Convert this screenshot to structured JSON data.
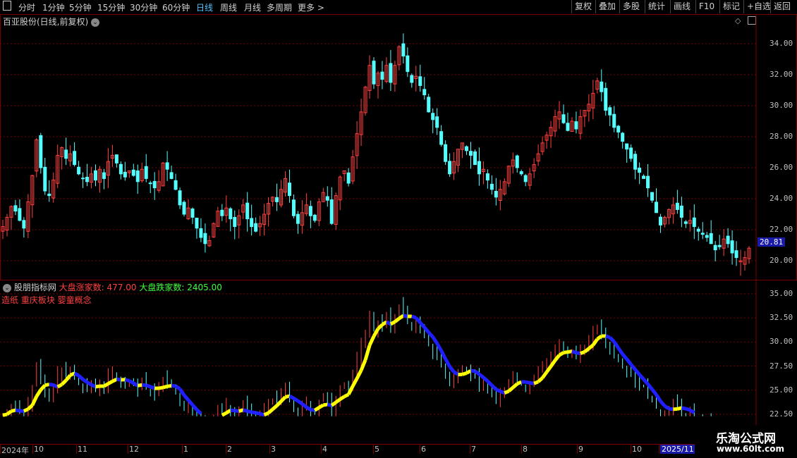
{
  "toolbar": {
    "left_items": [
      "分时",
      "1分钟",
      "5分钟",
      "15分钟",
      "30分钟",
      "60分钟",
      "日线",
      "周线",
      "月线",
      "多周期",
      "更多 >"
    ],
    "active_item": "日线",
    "right_items": [
      "复权",
      "叠加",
      "多股",
      "统计",
      "画线",
      "F10",
      "标记",
      "+自选",
      "返回"
    ]
  },
  "main_panel": {
    "title": "百亚股份(日线,前复权)",
    "price_axis": [
      "34.00",
      "32.00",
      "30.00",
      "28.00",
      "26.00",
      "24.00",
      "22.00",
      "20.00"
    ],
    "current_price": "20.81"
  },
  "indicator_panel": {
    "name": "股朋指标网",
    "up_label": "大盘涨家数: 477.00",
    "down_label": "大盘跌家数: 2405.00",
    "concepts": "造纸 重庆板块 婴童概念",
    "axis": [
      "35.00",
      "32.50",
      "30.00",
      "27.50",
      "25.00",
      "22.50"
    ]
  },
  "time_axis": {
    "labels": [
      "2024年",
      "10",
      "11",
      "12",
      "1",
      "2",
      "3",
      "4",
      "5",
      "6",
      "7",
      "8",
      "9",
      "10",
      "2025/11"
    ]
  },
  "watermark": {
    "line1": "乐淘公式网",
    "line2": "www.60lt.com"
  },
  "colors": {
    "up": "#ff4040",
    "down": "#54ffff",
    "line_up": "#ffff00",
    "line_down": "#2020ff",
    "grid": "#7a0000",
    "active_tab": "#4fc3ff"
  },
  "chart_data": {
    "type": "candlestick",
    "ylim": [
      19.5,
      35
    ],
    "closes": [
      22.2,
      22.8,
      23.5,
      23.2,
      22.6,
      22.1,
      23.8,
      25.5,
      27.8,
      26.0,
      24.5,
      24.2,
      25.2,
      26.8,
      27.3,
      26.6,
      26.9,
      26.2,
      25.6,
      25.3,
      25.1,
      25.6,
      25.2,
      25.9,
      25.3,
      26.4,
      26.8,
      26.3,
      25.6,
      25.4,
      25.8,
      25.5,
      25.1,
      25.9,
      25.3,
      25.0,
      24.7,
      25.1,
      26.3,
      25.9,
      25.3,
      24.6,
      23.6,
      23.0,
      23.4,
      22.8,
      22.1,
      21.5,
      21.1,
      21.3,
      22.4,
      23.2,
      22.9,
      23.4,
      22.7,
      22.2,
      22.9,
      23.6,
      22.7,
      22.2,
      21.9,
      22.4,
      23.0,
      23.7,
      24.1,
      23.8,
      24.6,
      25.3,
      24.2,
      22.9,
      22.4,
      23.1,
      23.6,
      22.9,
      22.6,
      23.8,
      24.4,
      23.9,
      22.4,
      24.2,
      25.4,
      25.8,
      25.0,
      26.7,
      28.2,
      29.6,
      31.2,
      32.6,
      31.4,
      32.1,
      31.7,
      32.6,
      31.5,
      32.6,
      33.8,
      33.2,
      32.2,
      31.5,
      31.9,
      31.3,
      30.7,
      29.6,
      29.1,
      28.6,
      27.5,
      26.4,
      25.6,
      26.4,
      27.2,
      27.6,
      27.1,
      26.8,
      26.2,
      25.6,
      25.9,
      25.2,
      24.6,
      24.1,
      24.6,
      25.1,
      26.1,
      26.5,
      26.0,
      25.6,
      25.1,
      25.6,
      26.2,
      26.9,
      27.6,
      28.1,
      28.6,
      29.3,
      29.6,
      28.9,
      28.4,
      29.0,
      28.5,
      29.3,
      29.7,
      30.1,
      30.8,
      31.6,
      30.9,
      29.7,
      29.4,
      28.6,
      28.3,
      27.7,
      27.2,
      26.6,
      25.9,
      25.7,
      25.3,
      24.7,
      23.9,
      23.1,
      22.3,
      22.8,
      23.3,
      23.6,
      23.3,
      22.8,
      22.4,
      22.6,
      22.2,
      21.9,
      21.7,
      21.5,
      21.1,
      20.7,
      20.9,
      21.4,
      21.1,
      20.5,
      20.2,
      20.0,
      20.2,
      20.81
    ]
  }
}
